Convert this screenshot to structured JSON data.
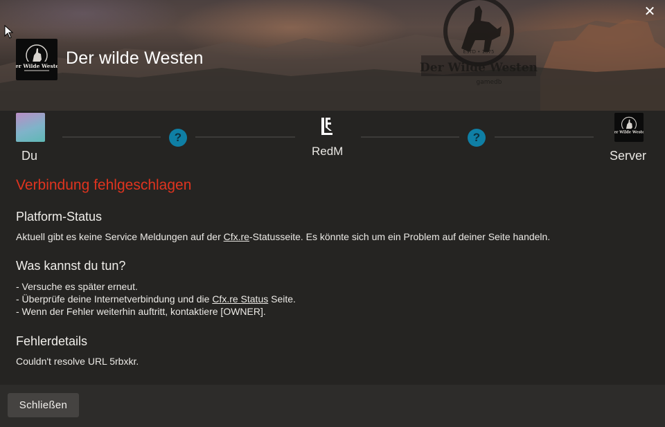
{
  "server": {
    "name": "Der wilde Westen",
    "logo_text": "Der Wilde Westen",
    "watermark_text": "Der Wilde Westen",
    "watermark_small": "ESTD • 1875",
    "watermark_sub": "gamedb"
  },
  "connection": {
    "you_label": "Du",
    "middle_label": "RedM",
    "server_label": "Server",
    "unknown_glyph": "?",
    "status_color": "#0f7fa5"
  },
  "error": {
    "title": "Verbindung fehlgeschlagen",
    "title_color": "#e0341f"
  },
  "platform_status": {
    "heading": "Platform-Status",
    "text_before": "Aktuell gibt es keine Service Meldungen auf der ",
    "link": "Cfx.re",
    "text_after": "-Statusseite. Es könnte sich um ein Problem auf deiner Seite handeln."
  },
  "what_to_do": {
    "heading": "Was kannst du tun?",
    "item1": "- Versuche es später erneut.",
    "item2_before": "- Überprüfe deine Internetverbindung und die ",
    "item2_link": "Cfx.re Status",
    "item2_after": " Seite.",
    "item3": "- Wenn der Fehler weiterhin auftritt, kontaktiere [OWNER]."
  },
  "error_details": {
    "heading": "Fehlerdetails",
    "text": "Couldn't resolve URL 5rbxkr."
  },
  "footer": {
    "close_label": "Schließen"
  },
  "icons": {
    "close": "close-icon",
    "help": "question-icon",
    "redm": "redm-logo-icon"
  }
}
